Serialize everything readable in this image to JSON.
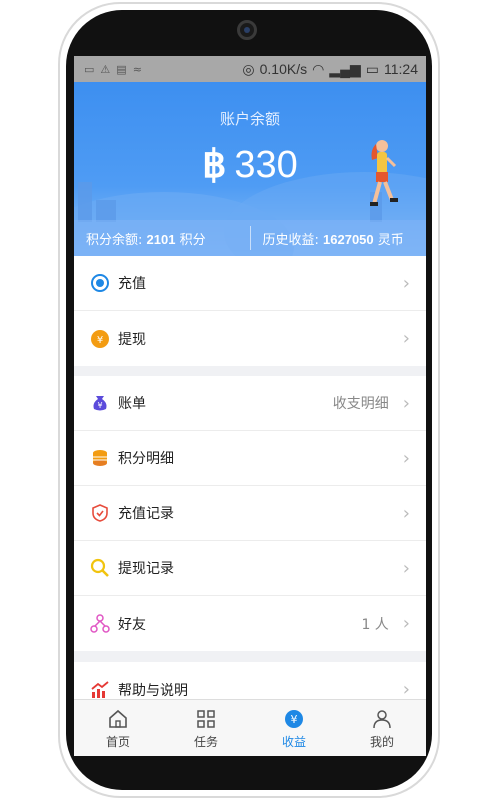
{
  "status_bar": {
    "left_icons": [
      "sim-icon",
      "warning-icon",
      "nfc-icon",
      "wifi-call-icon"
    ],
    "speed": "0.10K/s",
    "time": "11:24"
  },
  "header": {
    "title": "账户余额",
    "amount": "330",
    "currency_icon": "bitcoin-icon",
    "points_label": "积分余额:",
    "points_value": "2101",
    "points_unit": "积分",
    "history_label": "历史收益:",
    "history_value": "1627050",
    "history_unit": "灵币"
  },
  "groups": [
    {
      "items": [
        {
          "icon": "recharge-icon",
          "label": "充值",
          "extra": ""
        },
        {
          "icon": "withdraw-icon",
          "label": "提现",
          "extra": ""
        }
      ]
    },
    {
      "items": [
        {
          "icon": "bill-icon",
          "label": "账单",
          "extra": "收支明细"
        },
        {
          "icon": "points-detail-icon",
          "label": "积分明细",
          "extra": ""
        },
        {
          "icon": "recharge-record-icon",
          "label": "充值记录",
          "extra": ""
        },
        {
          "icon": "withdraw-record-icon",
          "label": "提现记录",
          "extra": ""
        },
        {
          "icon": "friends-icon",
          "label": "好友",
          "extra": "1 人"
        }
      ]
    },
    {
      "items": [
        {
          "icon": "help-icon",
          "label": "帮助与说明",
          "extra": ""
        }
      ]
    }
  ],
  "tabbar": {
    "tabs": [
      {
        "icon": "home-icon",
        "label": "首页"
      },
      {
        "icon": "tasks-icon",
        "label": "任务"
      },
      {
        "icon": "earnings-icon",
        "label": "收益"
      },
      {
        "icon": "profile-icon",
        "label": "我的"
      }
    ],
    "active_index": 2
  },
  "colors": {
    "accent": "#1e88e5",
    "header_blue": "#4a96f2"
  }
}
